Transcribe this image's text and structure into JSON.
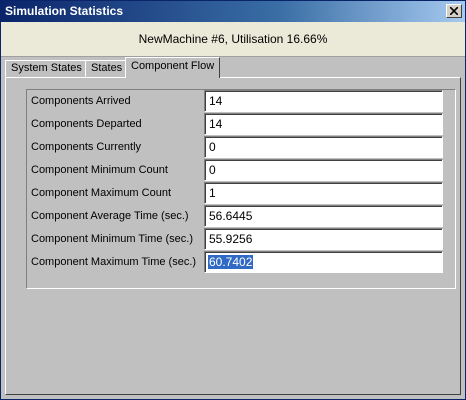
{
  "window": {
    "title": "Simulation Statistics"
  },
  "header": {
    "text": "NewMachine #6, Utilisation 16.66%"
  },
  "tabs": [
    {
      "label": "System States",
      "active": false
    },
    {
      "label": "States",
      "active": false
    },
    {
      "label": "Component Flow",
      "active": true
    }
  ],
  "fields": [
    {
      "label": "Components Arrived",
      "value": "14"
    },
    {
      "label": "Components Departed",
      "value": "14"
    },
    {
      "label": "Components Currently",
      "value": "0"
    },
    {
      "label": "Component Minimum Count",
      "value": "0"
    },
    {
      "label": "Component Maximum Count",
      "value": "1"
    },
    {
      "label": "Component Average Time (sec.)",
      "value": "56.6445"
    },
    {
      "label": "Component Minimum Time (sec.)",
      "value": "55.9256"
    },
    {
      "label": "Component Maximum Time (sec.)",
      "value": "60.7402",
      "selected": true
    }
  ],
  "colors": {
    "titlebar_start": "#0a246a",
    "selection": "#316ac5"
  },
  "icons": {
    "close": "close-icon"
  }
}
